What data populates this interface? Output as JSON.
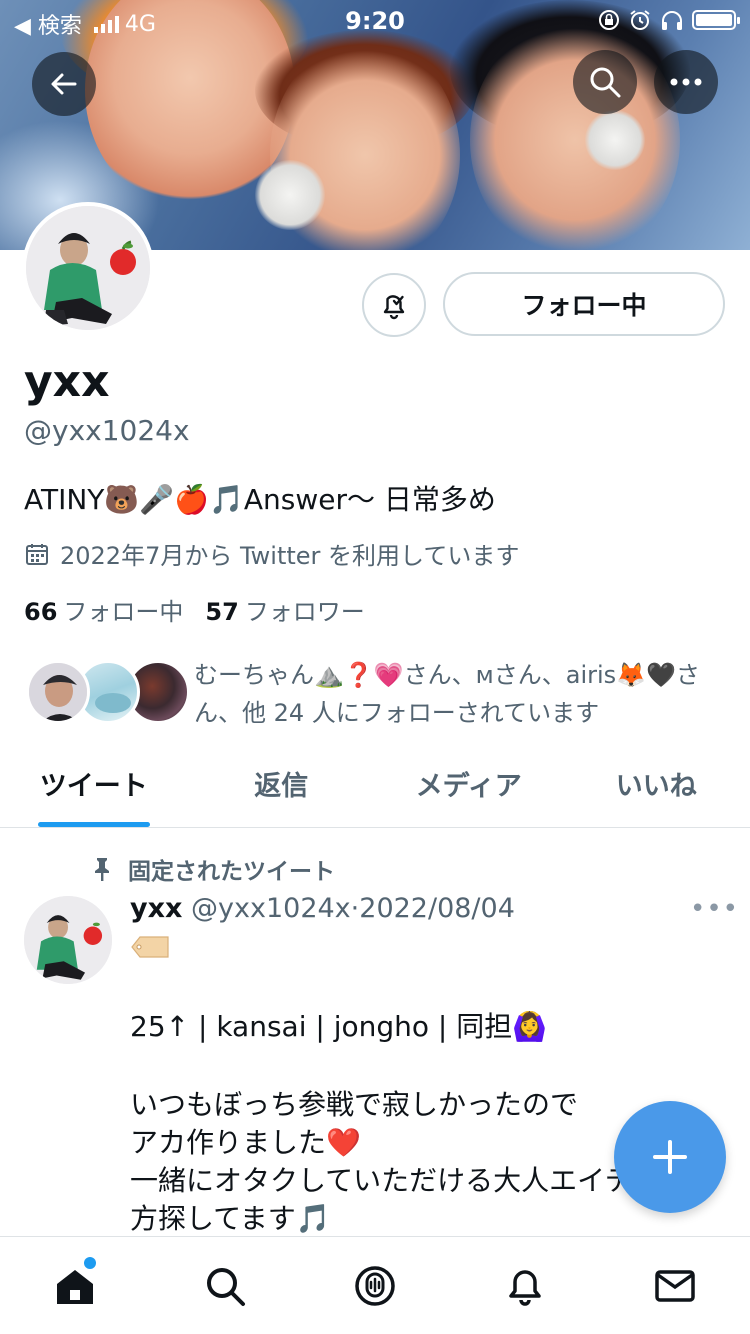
{
  "status_bar": {
    "carrier_back": "◀ 検索",
    "network": "4G",
    "time": "9:20"
  },
  "profile": {
    "display_name": "yxx",
    "handle": "@yxx1024x",
    "bio": "ATINY🐻🎤🍎🎵Answer〜 日常多め",
    "joined": "2022年7月から Twitter を利用しています",
    "following_count": "66",
    "following_label": "フォロー中",
    "followers_count": "57",
    "followers_label": "フォロワー",
    "follow_button": "フォロー中",
    "known_followers_text": "むーちゃん⛰️❓💗さん、ᴍさん、airis🦊🖤さん、他 24 人にフォローされています"
  },
  "tabs": [
    {
      "label": "ツイート",
      "active": true
    },
    {
      "label": "返信",
      "active": false
    },
    {
      "label": "メディア",
      "active": false
    },
    {
      "label": "いいね",
      "active": false
    }
  ],
  "tweet": {
    "pinned_label": "固定されたツイート",
    "name": "yxx",
    "handle": "@yxx1024x",
    "separator": "·",
    "date": "2022/08/04",
    "more": "•••",
    "tag_emoji": "🏷️",
    "line1": "25↑ |  kansai  |  jongho  |  同担🙆‍♀️",
    "line2": "いつもぼっち参戦で寂しかったので",
    "line3": "アカ作りました❤️",
    "line4": "一緒にオタクしていただける大人エイティ",
    "line5": "方探してます🎵"
  },
  "colors": {
    "accent": "#1d9bf0",
    "fab": "#4a99e9",
    "secondary_text": "#536471",
    "border": "#cfd9de"
  },
  "icons": {
    "back": "arrow-left-icon",
    "search": "search-icon",
    "more": "more-icon",
    "bell": "bell-icon",
    "calendar": "calendar-icon",
    "pin": "pin-icon",
    "compose": "plus-icon",
    "nav": [
      "home-icon",
      "search-icon",
      "spaces-icon",
      "notifications-icon",
      "messages-icon"
    ]
  }
}
